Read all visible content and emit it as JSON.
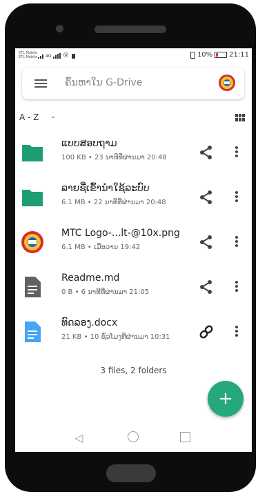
{
  "status_bar": {
    "carrier_1": "ETL Mobile",
    "carrier_2": "ETL Mobile",
    "network_label": "4G",
    "battery_percent": "10%",
    "time": "21:11"
  },
  "search": {
    "placeholder": "ຄົ້ນຫາໃນ G-Drive"
  },
  "sort": {
    "label": "A - Z",
    "chevron": "⌄"
  },
  "files": [
    {
      "name": "ແບບສອບຖາມ",
      "meta": "100 KB • 23 ນາທີທີ່ຜ່ານມາ 20:48",
      "type": "folder",
      "action": "share-icon"
    },
    {
      "name": "ລາຍຊື່ເຂົ້ານໍາໃຊ້ລະບົບ",
      "meta": "6.1 MB • 22 ນາທີທີ່ຜ່ານມາ 20:48",
      "type": "folder",
      "action": "share-icon"
    },
    {
      "name": "MTC Logo-...lt-@10x.png",
      "meta": "6.1 MB • ເມື່ອວານ 19:42",
      "type": "image",
      "action": "share-icon"
    },
    {
      "name": "Readme.md",
      "meta": "0 B • 6 ນາທີທີ່ຜ່ານມາ 21:05",
      "type": "text",
      "action": "share-icon"
    },
    {
      "name": "ທົດລອງ.docx",
      "meta": "21 KB • 10 ຊົ່ວໂມງທີ່ຜ່ານມາ 10:31",
      "type": "doc",
      "action": "link-icon"
    }
  ],
  "summary": "3 files, 2 folders",
  "fab_label": "+",
  "colors": {
    "folder": "#1e9e73",
    "fab": "#26a97a",
    "text_file": "#616161",
    "doc_file": "#42a5f5"
  }
}
